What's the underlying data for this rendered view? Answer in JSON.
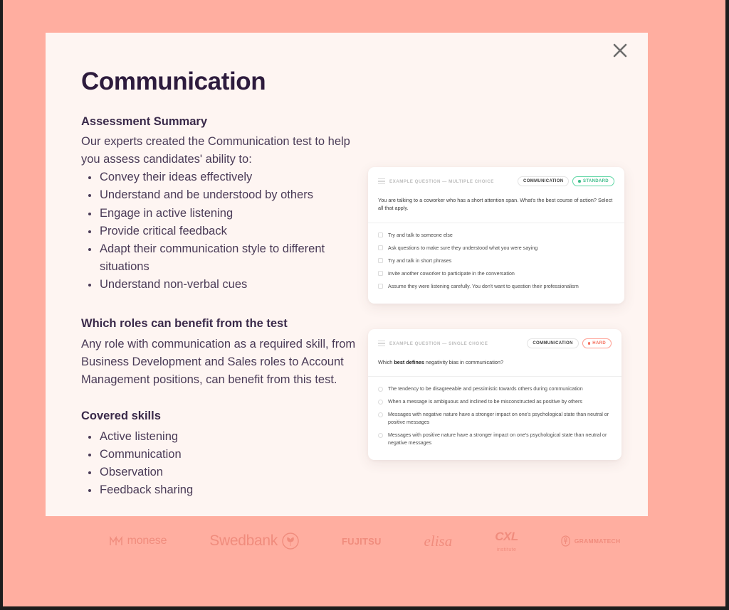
{
  "window": {
    "background_color": "#FFAEA0",
    "modal_background_color": "#FEF5F2",
    "title_color": "#2D1B3D"
  },
  "modal": {
    "close_label": "×",
    "title": "Communication",
    "sections": [
      {
        "heading": "Assessment Summary",
        "paragraph": "Our experts created the Communication test to help you assess candidates' ability to:",
        "bullets": [
          "Convey their ideas effectively",
          "Understand and be understood by others",
          "Engage in active listening",
          "Provide critical feedback",
          "Adapt their communication style to different situations",
          "Understand non-verbal cues"
        ]
      },
      {
        "heading": "Which roles can benefit from the test",
        "paragraph": "Any role with communication as a required skill, from Business Development and Sales roles to Account Management positions, can benefit from this test.",
        "bullets": []
      },
      {
        "heading": "Covered skills",
        "paragraph": "",
        "bullets": [
          "Active listening",
          "Communication",
          "Observation",
          "Feedback sharing"
        ]
      }
    ]
  },
  "question_cards": [
    {
      "kicker": "EXAMPLE QUESTION — MULTIPLE CHOICE",
      "category_badge": "COMMUNICATION",
      "level_badge": "STANDARD",
      "level_color": "#3FBD8A",
      "question_prefix": "You are talking to a coworker who has a short attention span. What's the best course of action? Select all that apply.",
      "question_bold": "",
      "question_suffix": "",
      "input_type": "checkbox",
      "options": [
        "Try and talk to someone else",
        "Ask questions to make sure they understood what you were saying",
        "Try and talk in short phrases",
        "Invite another coworker to participate in the conversation",
        "Assume they were listening carefully. You don't want to question their professionalism"
      ]
    },
    {
      "kicker": "EXAMPLE QUESTION — SINGLE CHOICE",
      "category_badge": "COMMUNICATION",
      "level_badge": "HARD",
      "level_color": "#F4705E",
      "question_prefix": "Which ",
      "question_bold": "best defines",
      "question_suffix": " negativity bias in communication?",
      "input_type": "radio",
      "options": [
        "The tendency to be disagreeable and pessimistic towards others during communication",
        "When a message is ambiguous and inclined to be misconstructed as positive by others",
        "Messages with negative nature have a stronger impact on one's psychological state than neutral or positive messages",
        "Messages with positive nature have a stronger impact on one's psychological state than neutral or negative messages"
      ]
    }
  ],
  "logos": [
    {
      "name": "monese",
      "label": "monese"
    },
    {
      "name": "swedbank",
      "label": "Swedbank"
    },
    {
      "name": "fujitsu",
      "label": "FUJITSU"
    },
    {
      "name": "elisa",
      "label": "elisa"
    },
    {
      "name": "cxl",
      "label": "CXL",
      "sub": "institute"
    },
    {
      "name": "grammatech",
      "label": "GRAMMATECH"
    }
  ]
}
